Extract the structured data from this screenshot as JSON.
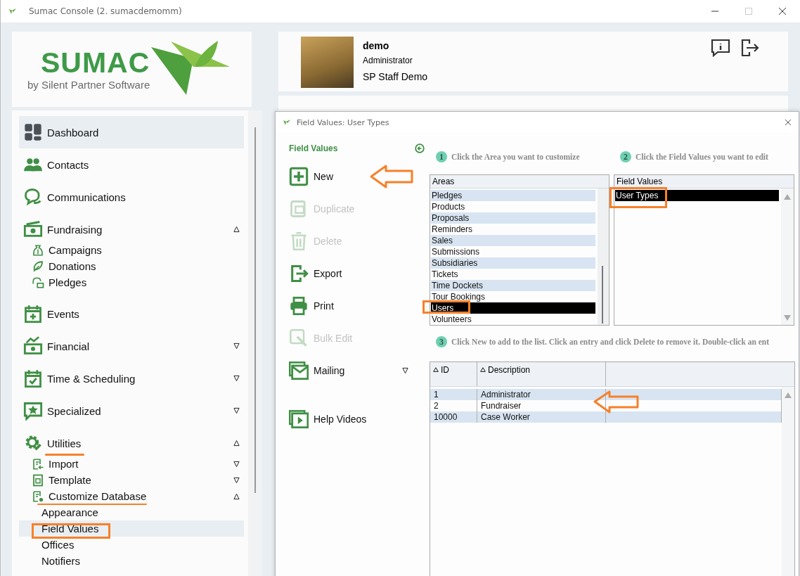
{
  "window": {
    "title": "Sumac Console (2. sumacdemomm)"
  },
  "logo": {
    "name": "SUMAC",
    "tagline": "by Silent Partner Software"
  },
  "sidebar": {
    "items": [
      {
        "label": "Dashboard",
        "selected": true
      },
      {
        "label": "Contacts",
        "selected": false
      },
      {
        "label": "Communications",
        "selected": false
      },
      {
        "label": "Fundraising",
        "selected": false,
        "expanded": true,
        "children": [
          {
            "label": "Campaigns",
            "selected": false
          },
          {
            "label": "Donations",
            "selected": false
          },
          {
            "label": "Pledges",
            "selected": false
          }
        ]
      },
      {
        "label": "Events",
        "selected": false
      },
      {
        "label": "Financial",
        "selected": false,
        "expanded": false
      },
      {
        "label": "Time & Scheduling",
        "selected": false,
        "expanded": false
      },
      {
        "label": "Specialized",
        "selected": false,
        "expanded": false
      },
      {
        "label": "Utilities",
        "selected": false,
        "expanded": true,
        "children": [
          {
            "label": "Import",
            "selected": false,
            "expanded": false
          },
          {
            "label": "Template",
            "selected": false,
            "expanded": false
          },
          {
            "label": "Customize Database",
            "selected": false,
            "expanded": true,
            "children": [
              {
                "label": "Appearance",
                "selected": false
              },
              {
                "label": "Field Values",
                "selected": true
              },
              {
                "label": "Offices",
                "selected": false
              },
              {
                "label": "Notifiers",
                "selected": false
              }
            ]
          }
        ]
      }
    ]
  },
  "user": {
    "name": "demo",
    "role": "Administrator",
    "organization": "SP Staff Demo"
  },
  "dialog": {
    "title": "Field Values: User Types",
    "toolbar": {
      "heading": "Field Values",
      "buttons": [
        {
          "label": "New",
          "disabled": false
        },
        {
          "label": "Duplicate",
          "disabled": true
        },
        {
          "label": "Delete",
          "disabled": true
        },
        {
          "label": "Export",
          "disabled": false
        },
        {
          "label": "Print",
          "disabled": false
        },
        {
          "label": "Bulk Edit",
          "disabled": true
        },
        {
          "label": "Mailing",
          "disabled": false,
          "expanded": false
        },
        {
          "label": "Help Videos",
          "disabled": false
        }
      ]
    },
    "steps": [
      {
        "number": "1",
        "text": "Click the Area you want to customize"
      },
      {
        "number": "2",
        "text": "Click the Field Values you want to edit"
      },
      {
        "number": "3",
        "text": "Click New to add to the list. Click an entry and click Delete to remove it. Double-click an ent"
      }
    ],
    "areas": {
      "header": "Areas",
      "items": [
        {
          "label": "Pledges",
          "selected": false
        },
        {
          "label": "Products",
          "selected": false
        },
        {
          "label": "Proposals",
          "selected": false
        },
        {
          "label": "Reminders",
          "selected": false
        },
        {
          "label": "Sales",
          "selected": false
        },
        {
          "label": "Submissions",
          "selected": false
        },
        {
          "label": "Subsidiaries",
          "selected": false
        },
        {
          "label": "Tickets",
          "selected": false
        },
        {
          "label": "Time Dockets",
          "selected": false
        },
        {
          "label": "Tour Bookings",
          "selected": false
        },
        {
          "label": "Users",
          "selected": true
        },
        {
          "label": "Volunteers",
          "selected": false
        }
      ]
    },
    "field_values": {
      "header": "Field Values",
      "items": [
        {
          "label": "User Types",
          "selected": true
        }
      ]
    },
    "table": {
      "columns": [
        "ID",
        "Description"
      ],
      "rows": [
        [
          "1",
          "Administrator"
        ],
        [
          "2",
          "Fundraiser"
        ],
        [
          "10000",
          "Case Worker"
        ]
      ]
    }
  }
}
